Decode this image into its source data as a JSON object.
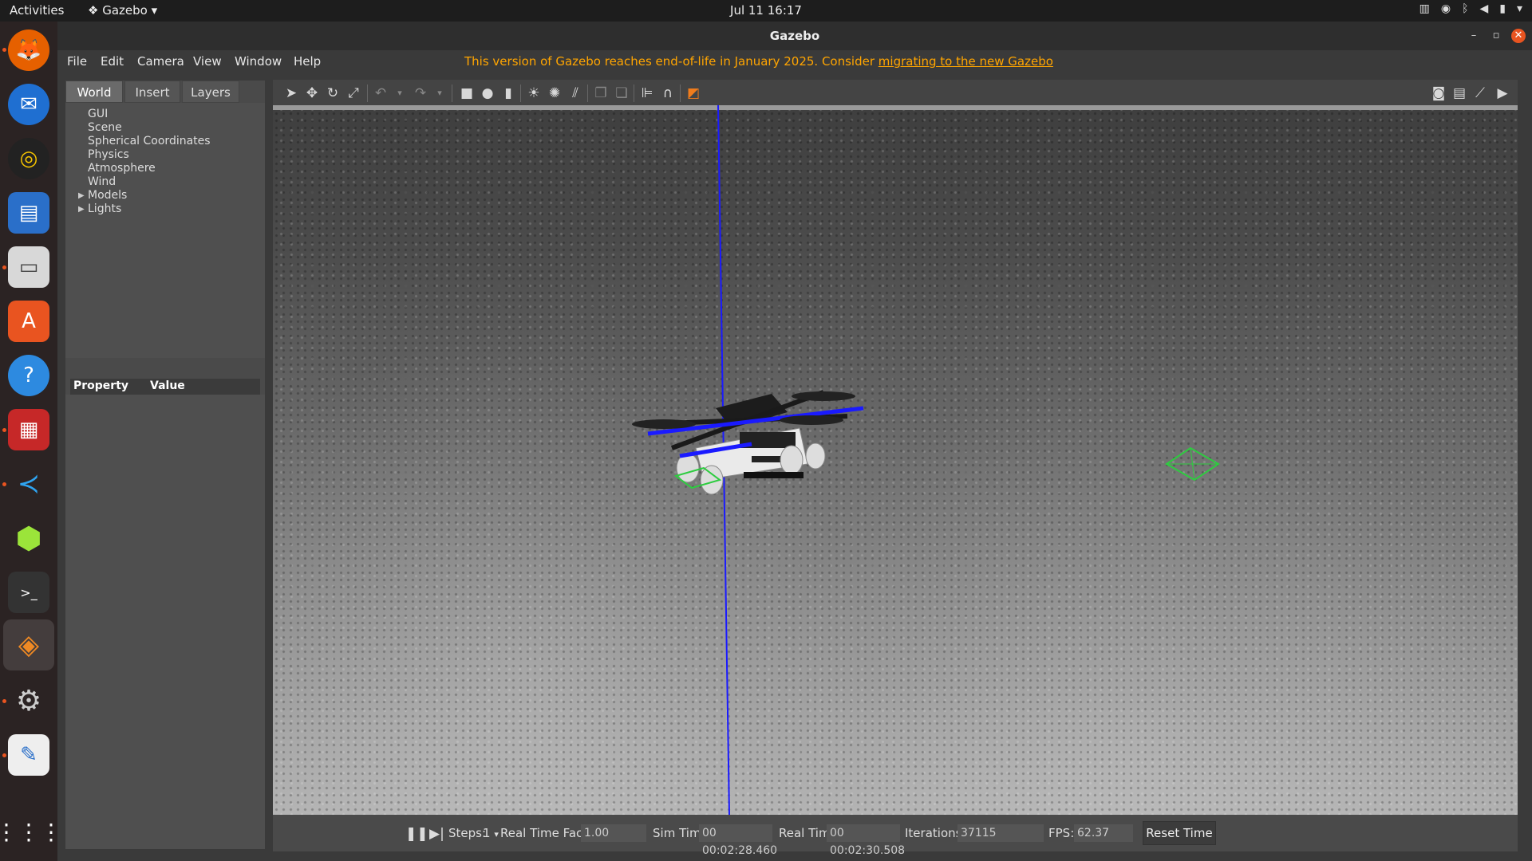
{
  "topbar": {
    "activities": "Activities",
    "app_menu": "Gazebo",
    "clock": "Jul 11  16:17"
  },
  "dock": {
    "items": [
      "firefox-icon",
      "thunderbird-icon",
      "rhythmbox-icon",
      "writer-icon",
      "files-icon",
      "software-icon",
      "help-icon",
      "terminal-app-icon",
      "vscode-icon",
      "cube-icon",
      "terminal-icon",
      "gazebo-icon",
      "settings-icon",
      "text-editor-icon",
      "apps-grid-icon"
    ]
  },
  "window": {
    "title": "Gazebo"
  },
  "menubar": {
    "items": [
      "File",
      "Edit",
      "Camera",
      "View",
      "Window",
      "Help"
    ],
    "notice_text": "This version of Gazebo reaches end-of-life in January 2025. Consider ",
    "notice_link": "migrating to the new Gazebo"
  },
  "left_panel": {
    "tabs": [
      "World",
      "Insert",
      "Layers"
    ],
    "tree": [
      "GUI",
      "Scene",
      "Spherical Coordinates",
      "Physics",
      "Atmosphere",
      "Wind",
      "Models",
      "Lights"
    ],
    "property_header": "Property",
    "value_header": "Value"
  },
  "bottombar": {
    "steps_label": "Steps:",
    "steps_value": "1",
    "rtf_label": "Real Time Factor:",
    "rtf_value": "1.00",
    "sim_time_label": "Sim Time:",
    "sim_time_value": "00 00:02:28.460",
    "real_time_label": "Real Time:",
    "real_time_value": "00 00:02:30.508",
    "iterations_label": "Iterations:",
    "iterations_value": "37115",
    "fps_label": "FPS:",
    "fps_value": "62.37",
    "reset_button": "Reset Time"
  }
}
